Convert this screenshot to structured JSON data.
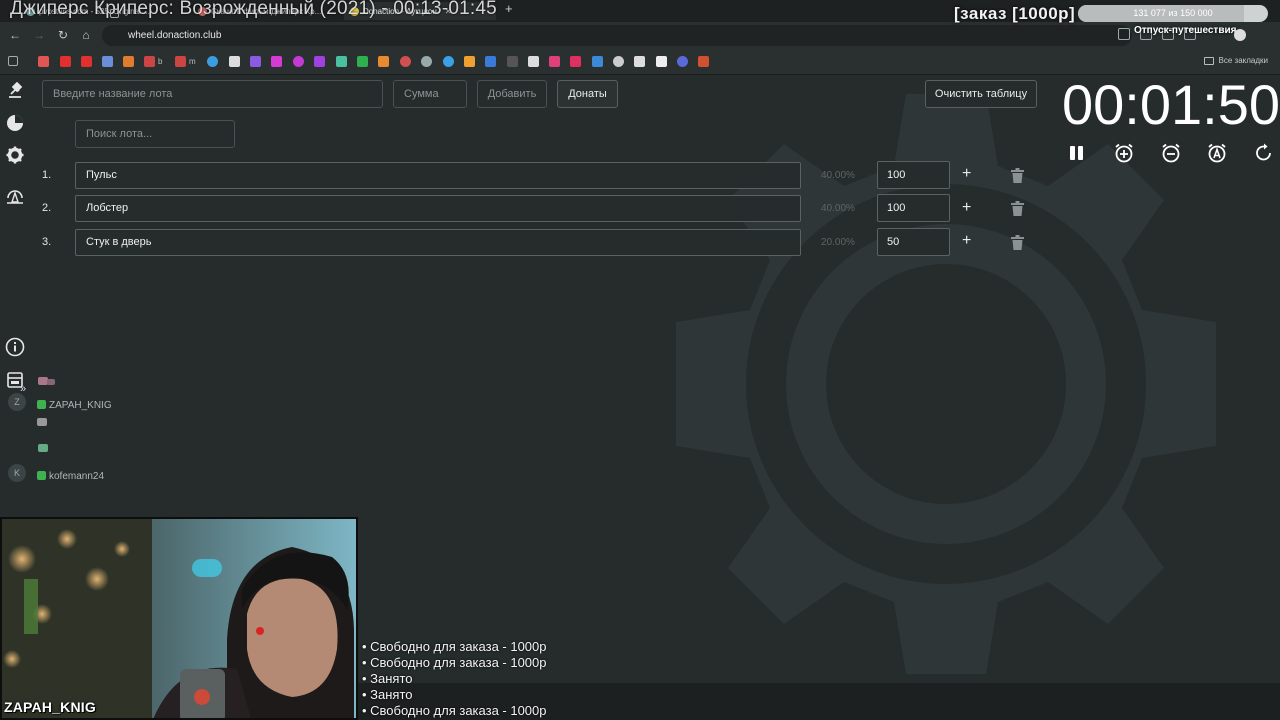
{
  "browser": {
    "tabs": [
      {
        "label": "pvpstuns.com - 525: Original ...",
        "active": false
      },
      {
        "label": "Скачать фильм Джиперс Кр...",
        "active": false
      },
      {
        "label": "Donaction - Аукцион",
        "active": true
      }
    ],
    "url": "wheel.donaction.club",
    "bookmarks_all_label": "Все закладки"
  },
  "overlay": {
    "stream_title": "Джиперс Криперс: Возрожденный (2021) - 00:13-01:45",
    "order_badge": "[заказ [1000р]",
    "goal_text": "131 077 из 150 000",
    "goal_progress": 0.874,
    "goal_label": "Отпуск-путешествия"
  },
  "form": {
    "lot_name_placeholder": "Введите название лота",
    "sum_placeholder": "Сумма",
    "add_label": "Добавить",
    "donations_label": "Донаты",
    "clear_label": "Очистить таблицу",
    "search_placeholder": "Поиск лота..."
  },
  "lots": [
    {
      "num": "1.",
      "name": "Пульс",
      "percent": "40.00%",
      "amount": "100"
    },
    {
      "num": "2.",
      "name": "Лобстер",
      "percent": "40.00%",
      "amount": "100"
    },
    {
      "num": "3.",
      "name": "Стук в дверь",
      "percent": "20.00%",
      "amount": "50"
    }
  ],
  "timer": {
    "value": "00:01:50"
  },
  "chat": [
    {
      "user": "ZAPAH_KNIG",
      "avatar": "Z"
    },
    {
      "user": "kofemann24",
      "avatar": "K"
    }
  ],
  "webcam": {
    "streamer": "ZAPAH_KNIG"
  },
  "slots": [
    "• Свободно для заказа - 1000р",
    "• Свободно для заказа - 1000р",
    "• Занято",
    "• Занято",
    "• Свободно для заказа - 1000р"
  ],
  "colors": {
    "background": "#262b2b",
    "accent": "#ffffff",
    "border": "#5a6263"
  }
}
